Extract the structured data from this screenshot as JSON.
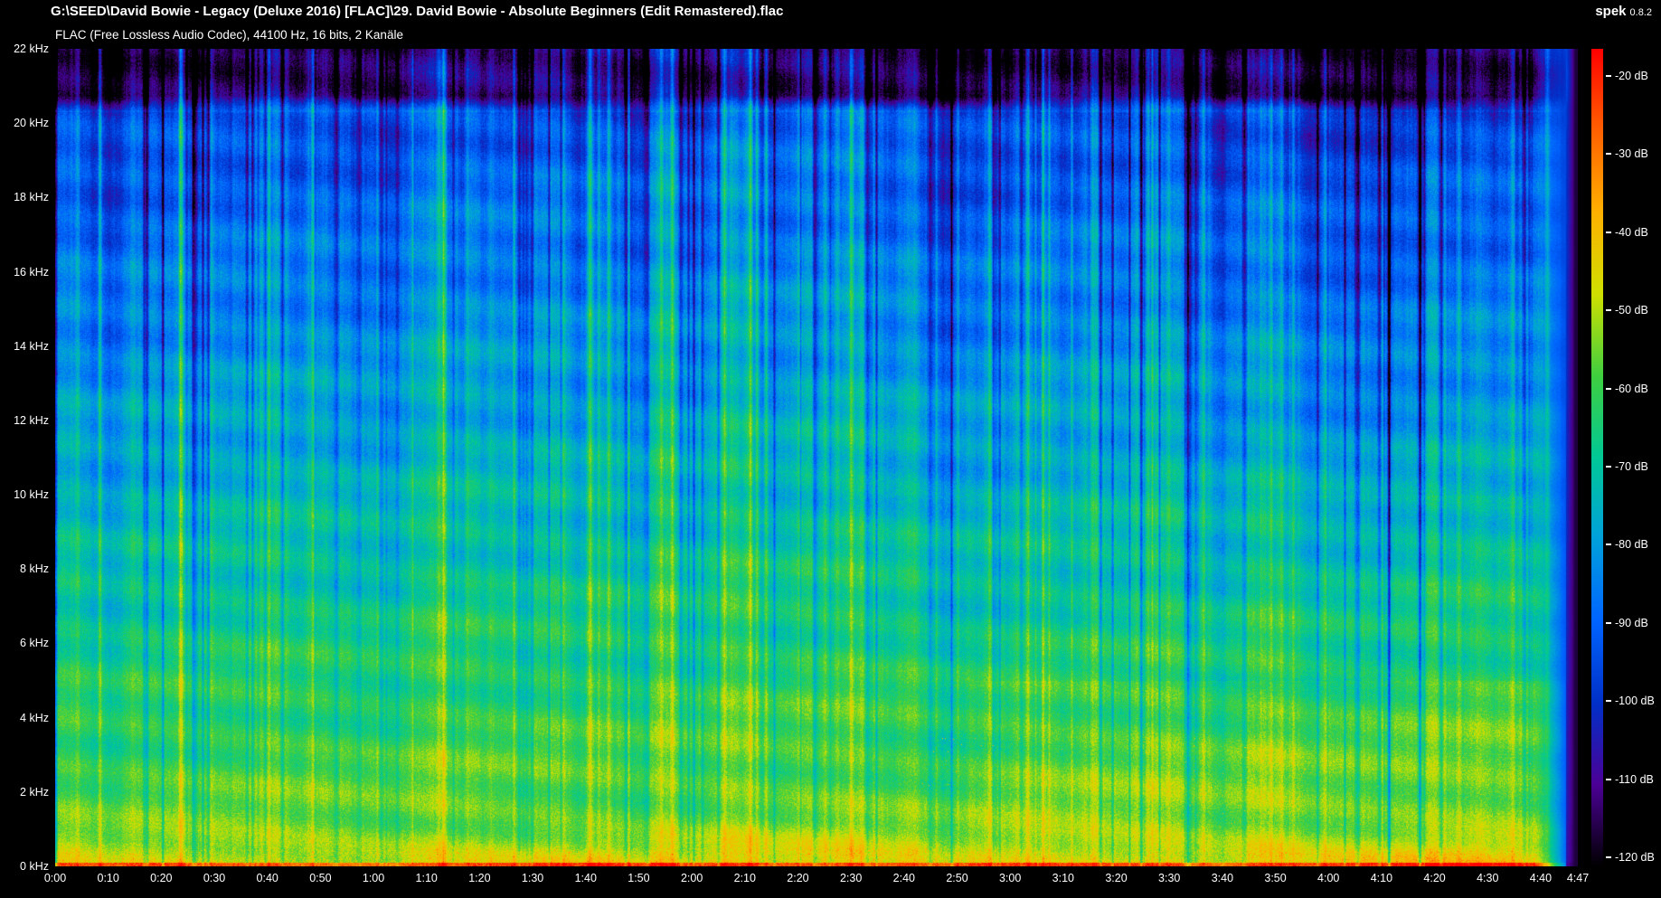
{
  "header": {
    "title": "G:\\SEED\\David Bowie - Legacy (Deluxe 2016) [FLAC]\\29. David Bowie - Absolute Beginners (Edit Remastered).flac",
    "app_name": "spek",
    "app_version": "0.8.2",
    "subtitle": "FLAC (Free Lossless Audio Codec), 44100 Hz, 16 bits, 2 Kanäle"
  },
  "chart_data": {
    "type": "heatmap",
    "title": "Audio spectrogram",
    "x_axis": {
      "unit": "time",
      "range_seconds": [
        0,
        287
      ],
      "tick_labels": [
        "0:00",
        "0:10",
        "0:20",
        "0:30",
        "0:40",
        "0:50",
        "1:00",
        "1:10",
        "1:20",
        "1:30",
        "1:40",
        "1:50",
        "2:00",
        "2:10",
        "2:20",
        "2:30",
        "2:40",
        "2:50",
        "3:00",
        "3:10",
        "3:20",
        "3:30",
        "3:40",
        "3:50",
        "4:00",
        "4:10",
        "4:20",
        "4:30",
        "4:40",
        "4:47"
      ]
    },
    "y_axis": {
      "unit": "kHz",
      "range_khz": [
        0,
        22
      ],
      "tick_labels": [
        "22 kHz",
        "20 kHz",
        "18 kHz",
        "16 kHz",
        "14 kHz",
        "12 kHz",
        "10 kHz",
        "8 kHz",
        "6 kHz",
        "4 kHz",
        "2 kHz",
        "0 kHz"
      ]
    },
    "legend": {
      "unit": "dB",
      "position": "right",
      "range_db": [
        -20,
        -120
      ],
      "tick_labels": [
        "-20 dB",
        "-30 dB",
        "-40 dB",
        "-50 dB",
        "-60 dB",
        "-70 dB",
        "-80 dB",
        "-90 dB",
        "-100 dB",
        "-110 dB",
        "-120 dB"
      ],
      "palette": [
        {
          "db": -20,
          "color": "#ff0000"
        },
        {
          "db": -30,
          "color": "#ff6000"
        },
        {
          "db": -40,
          "color": "#ffb000"
        },
        {
          "db": -50,
          "color": "#cfe000"
        },
        {
          "db": -60,
          "color": "#3fcf3f"
        },
        {
          "db": -70,
          "color": "#00c896"
        },
        {
          "db": -80,
          "color": "#00a0dc"
        },
        {
          "db": -90,
          "color": "#0064ff"
        },
        {
          "db": -100,
          "color": "#0030c8"
        },
        {
          "db": -110,
          "color": "#4b0096"
        },
        {
          "db": -120,
          "color": "#000000"
        }
      ]
    },
    "colors": {
      "background": "#000000",
      "text": "#ffffff"
    }
  }
}
